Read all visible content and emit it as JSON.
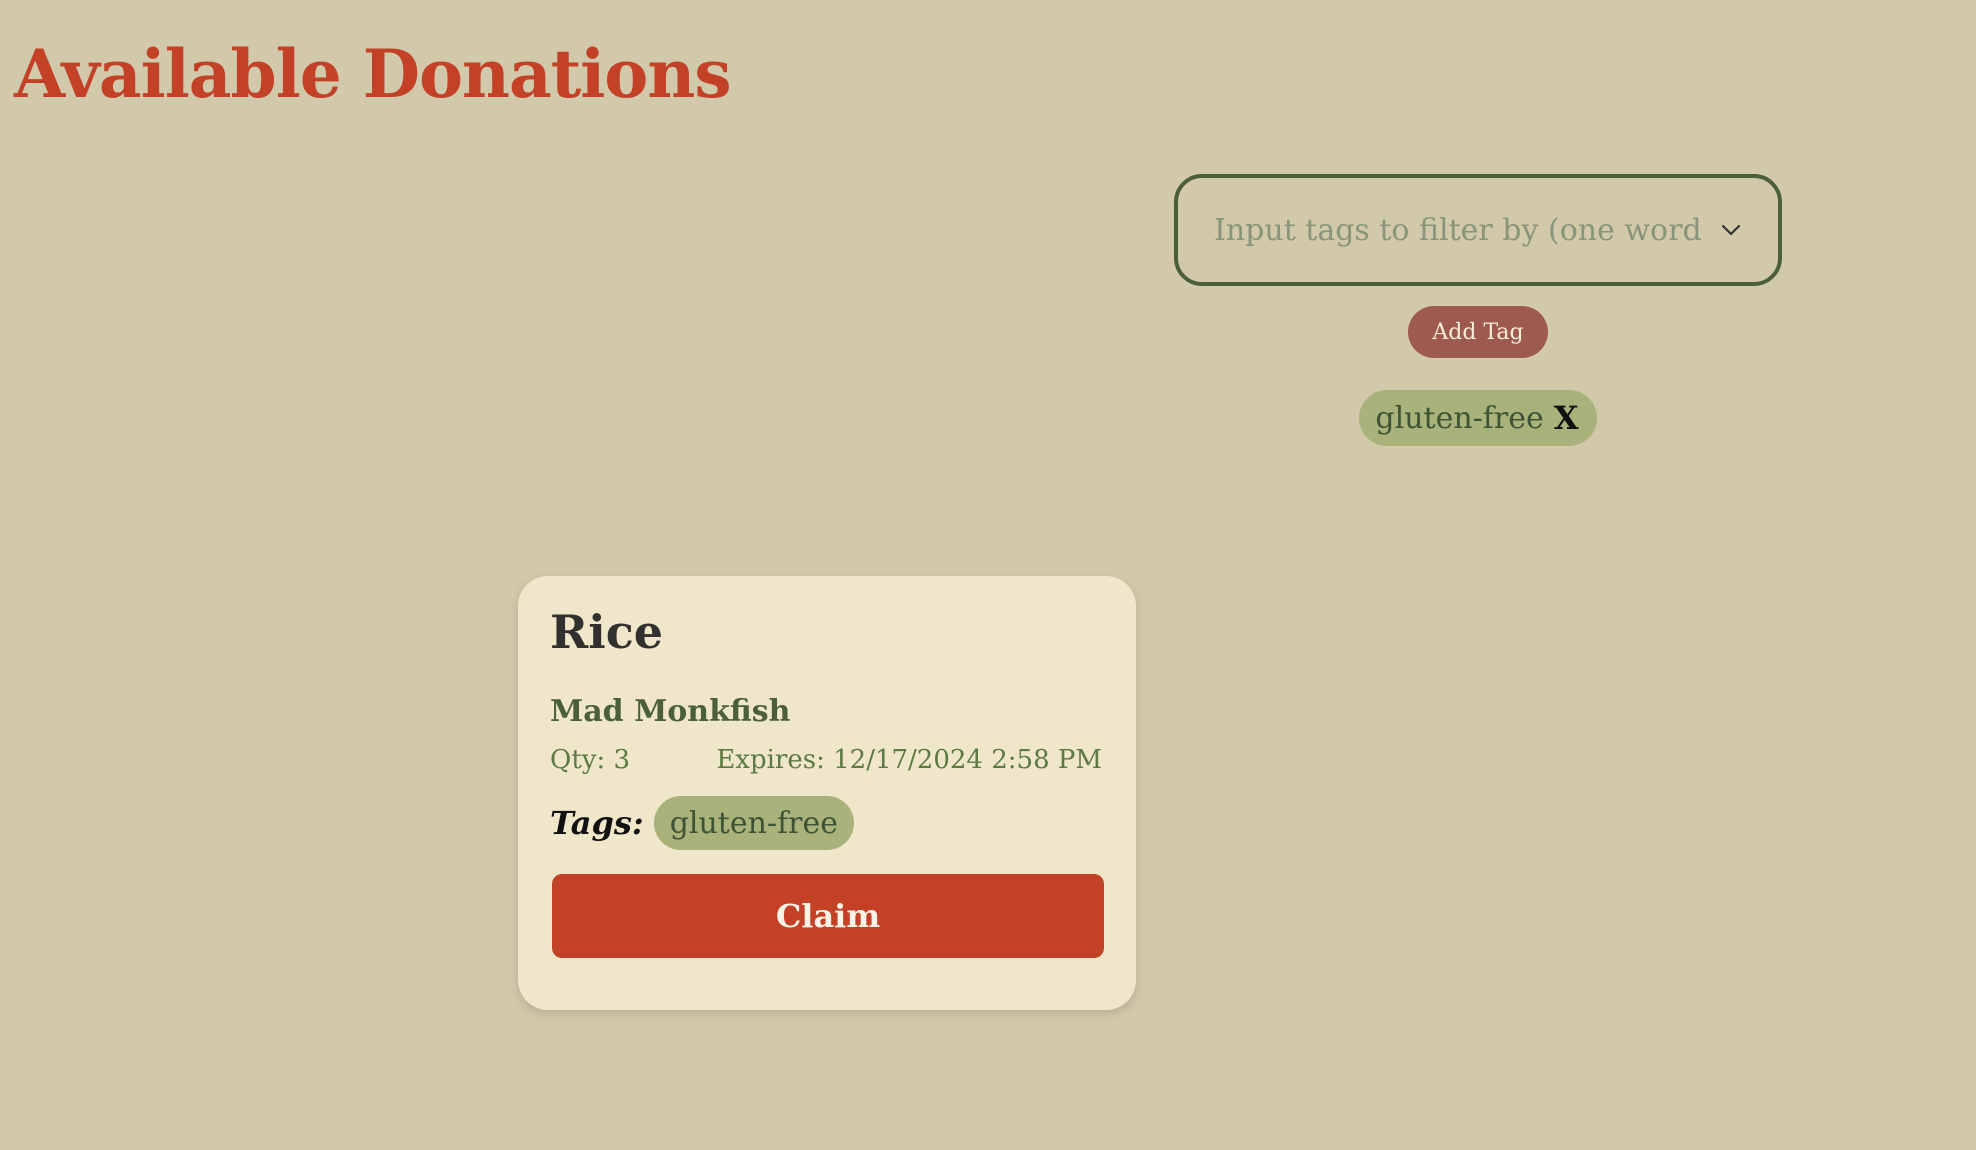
{
  "header": {
    "title": "Available Donations"
  },
  "filter": {
    "placeholder": "Input tags to filter by (one word)",
    "value": "",
    "dropdown_icon": "chevron-down-icon",
    "add_button_label": "Add Tag",
    "active_tags": [
      {
        "label": "gluten-free",
        "remove_label": "X"
      }
    ]
  },
  "donations": [
    {
      "name": "Rice",
      "donor": "Mad Monkfish",
      "qty": "Qty: 3",
      "expires": "Expires: 12/17/2024 2:58 PM",
      "tags_label": "Tags:",
      "tags": [
        "gluten-free"
      ],
      "claim_label": "Claim"
    }
  ],
  "colors": {
    "background": "#d2c8aa",
    "title": "#c24127",
    "accent_green": "#4b5f3c",
    "tag_pill": "#a8b27a",
    "add_button": "#9e5a4f",
    "claim_button": "#c24127",
    "card": "#f0e6c9"
  }
}
